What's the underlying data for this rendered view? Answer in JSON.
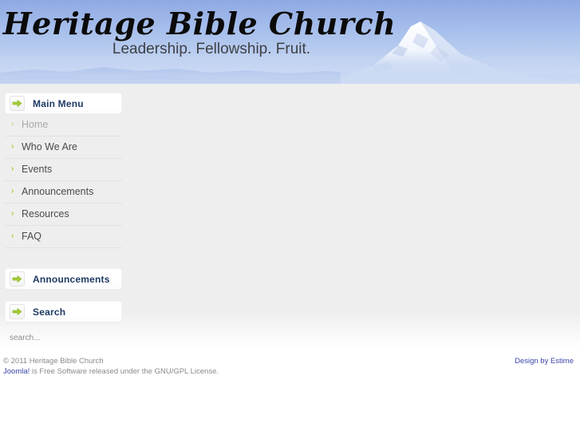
{
  "banner": {
    "site_title": "Heritage Bible Church",
    "tagline": "Leadership. Fellowship. Fruit.",
    "image_alt": "snow-capped-mountain-photo",
    "sky_color": "#9bb4e8",
    "ridge_color": "#7e9ade"
  },
  "sidebar": {
    "modules": [
      {
        "id": "main-menu",
        "title": "Main Menu",
        "icon": "green-right-arrow-icon",
        "items": [
          {
            "label": "Home",
            "active": true
          },
          {
            "label": "Who We Are",
            "active": false
          },
          {
            "label": "Events",
            "active": false
          },
          {
            "label": "Announcements",
            "active": false
          },
          {
            "label": "Resources",
            "active": false
          },
          {
            "label": "FAQ",
            "active": false
          }
        ]
      },
      {
        "id": "announcements",
        "title": "Announcements",
        "icon": "green-right-arrow-icon"
      },
      {
        "id": "search",
        "title": "Search",
        "icon": "green-right-arrow-icon",
        "search_value": "",
        "search_placeholder": "search..."
      }
    ]
  },
  "footer": {
    "copyright": "© 2011 Heritage Bible Church",
    "license_link": "Joomla!",
    "license_text": " is Free Software released under the GNU/GPL License.",
    "design_credit": "Design by Estime"
  },
  "theme": {
    "accent_green": "#a8cf3c",
    "heading_navy": "#1f3a63",
    "link_blue": "#3a44a8",
    "content_bg": "#eeeeee",
    "menu_text": "#4b4b4b"
  }
}
